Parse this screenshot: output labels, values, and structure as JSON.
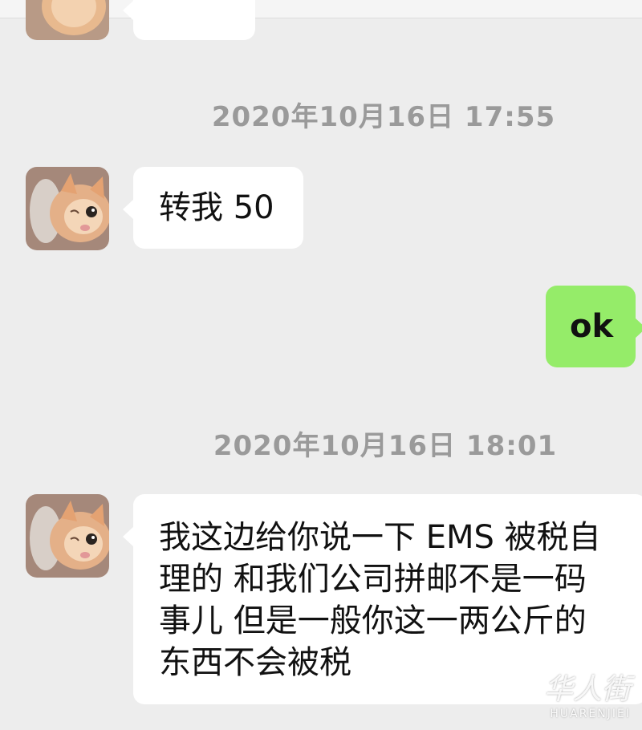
{
  "messages": [
    {
      "type": "timestamp",
      "text": "2020年10月16日 17:55"
    },
    {
      "type": "incoming",
      "text": "转我 50"
    },
    {
      "type": "outgoing",
      "text": "ok"
    },
    {
      "type": "timestamp",
      "text": "2020年10月16日 18:01"
    },
    {
      "type": "incoming",
      "lines": [
        "我这边给你说一下 EMS 被税自",
        "理的 和我们公司拼邮不是一码",
        "事儿 但是一般你这一两公斤的",
        "东西不会被税"
      ]
    }
  ],
  "contact": {
    "avatar_icon": "cat-avatar-icon"
  },
  "watermark": {
    "main": "华人街",
    "sub": "HUARENJIEI"
  },
  "colors": {
    "background": "#ededed",
    "incoming_bubble": "#ffffff",
    "outgoing_bubble": "#95ec69",
    "timestamp": "#9a9a9a"
  }
}
